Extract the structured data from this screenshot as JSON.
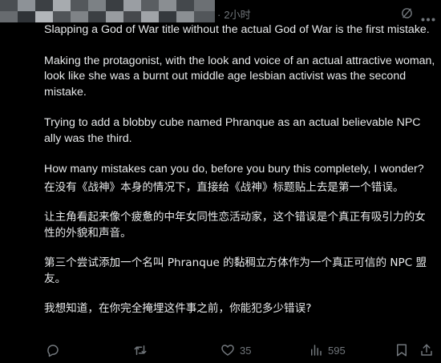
{
  "header": {
    "timestamp": "2小时",
    "avatar_blur_colors": [
      "#5f6469",
      "#8a8f94",
      "#3f4347",
      "#b5b9bd",
      "#6e7378",
      "#2e3236"
    ]
  },
  "tweet": {
    "paragraphs_en": [
      "Slapping a God of War title without the actual God of War is the first mistake.",
      "Making the protagonist, with the look and voice of an actual attractive woman, look like she was a burnt out middle age lesbian activist was the second mistake.",
      "Trying to add a blobby cube named Phranque as an actual believable NPC ally was the third.",
      "How many mistakes can you do, before you bury this completely, I wonder?"
    ],
    "paragraphs_zh": [
      "在没有《战神》本身的情况下，直接给《战神》标题贴上去是第一个错误。",
      "让主角看起来像个疲惫的中年女同性恋活动家，这个错误是个真正有吸引力的女性的外貌和声音。",
      "第三个尝试添加一个名叫 Phranque 的黏稠立方体作为一个真正可信的 NPC 盟友。",
      "我想知道，在你完全掩埋这件事之前，你能犯多少错误?"
    ]
  },
  "actions": {
    "reply_icon": "comment-icon",
    "retweet_icon": "repost-icon",
    "like_icon": "heart-icon",
    "like_count": "35",
    "views_icon": "analytics-icon",
    "views_count": "595",
    "bookmark_icon": "bookmark-icon",
    "share_icon": "share-icon"
  },
  "colors": {
    "background": "#000000",
    "text": "#e7e9ea",
    "muted": "#71767b"
  }
}
